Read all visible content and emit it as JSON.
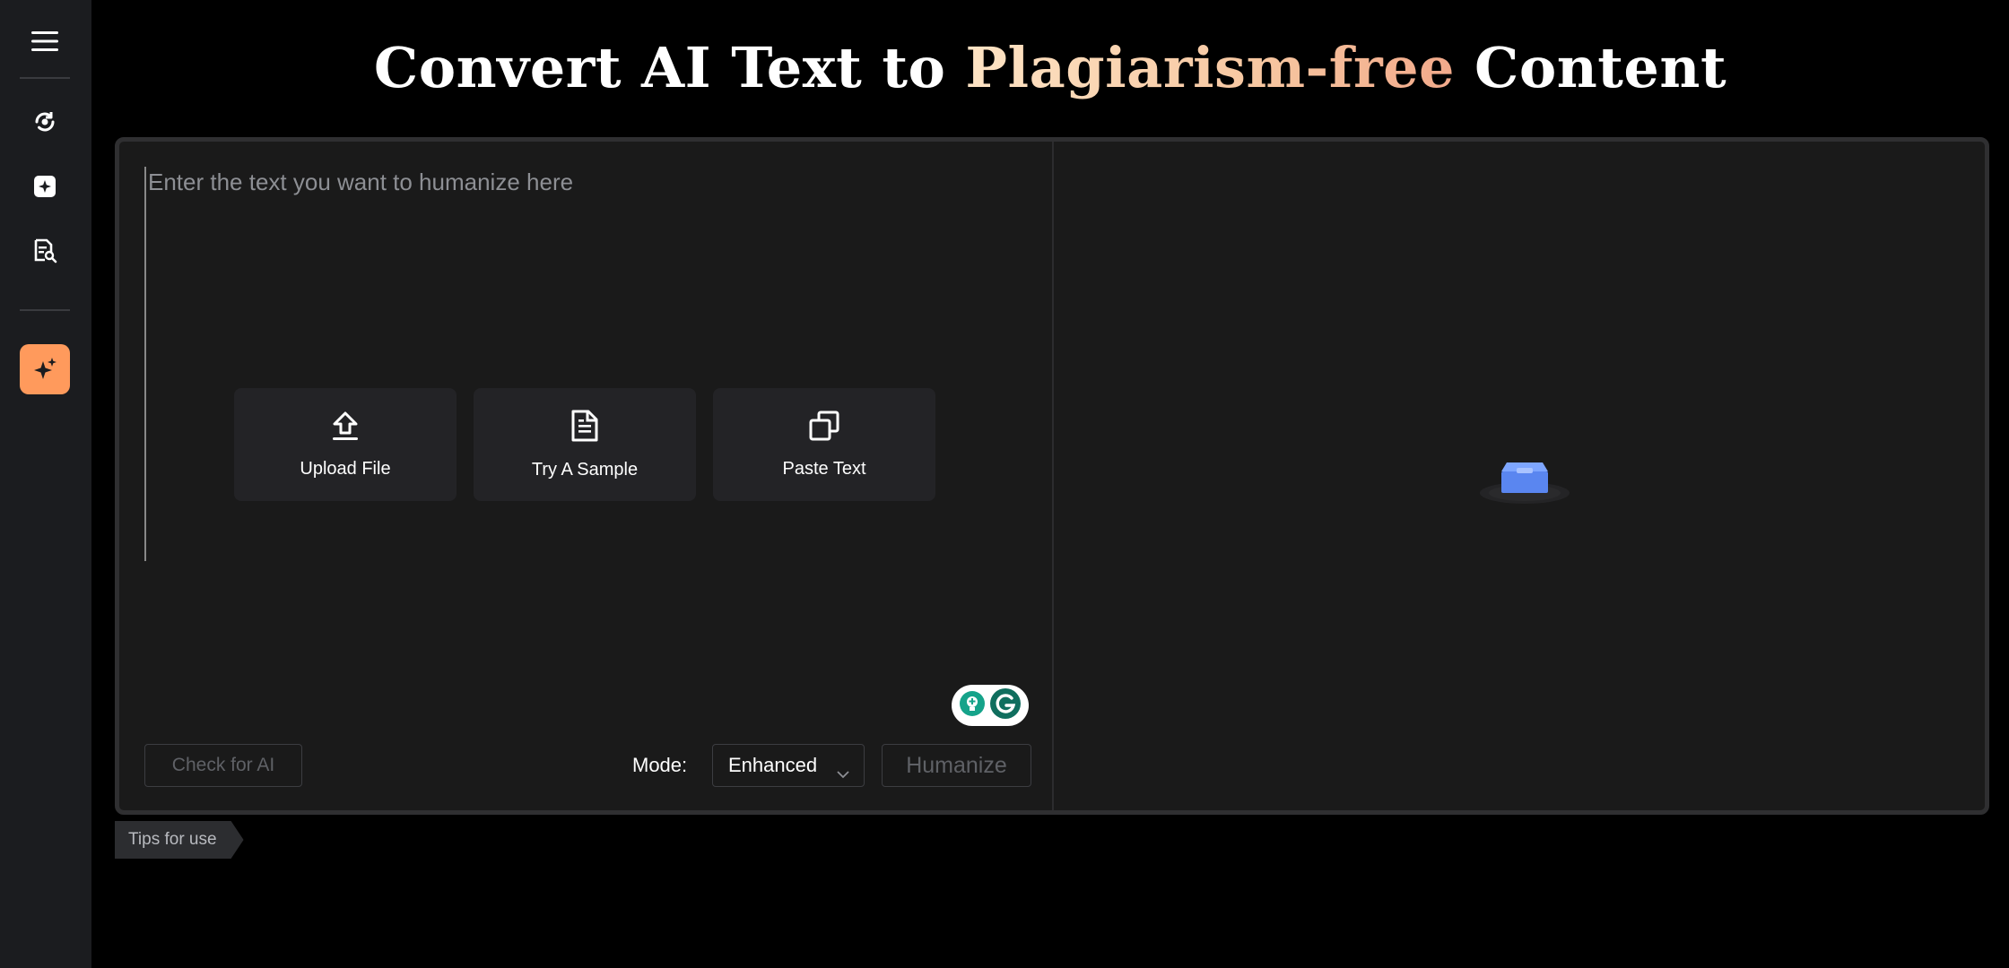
{
  "title": {
    "prefix": "Convert AI Text to",
    "highlight": "Plagiarism-free",
    "suffix": "Content"
  },
  "sidebar": {
    "items": [
      {
        "icon": "menu-icon"
      },
      {
        "icon": "rewrite-icon"
      },
      {
        "icon": "ai-plus-icon"
      },
      {
        "icon": "document-search-icon"
      },
      {
        "icon": "sparkles-icon",
        "active": true
      }
    ],
    "active_color": "#ff9a5c"
  },
  "editor": {
    "placeholder": "Enter the text you want to humanize here",
    "actions": [
      {
        "label": "Upload File",
        "icon": "upload-icon"
      },
      {
        "label": "Try A Sample",
        "icon": "document-icon"
      },
      {
        "label": "Paste Text",
        "icon": "copy-icon"
      }
    ],
    "check_label": "Check for AI",
    "mode_label": "Mode:",
    "mode_value": "Enhanced",
    "humanize_label": "Humanize"
  },
  "tips": {
    "label": "Tips for use"
  }
}
